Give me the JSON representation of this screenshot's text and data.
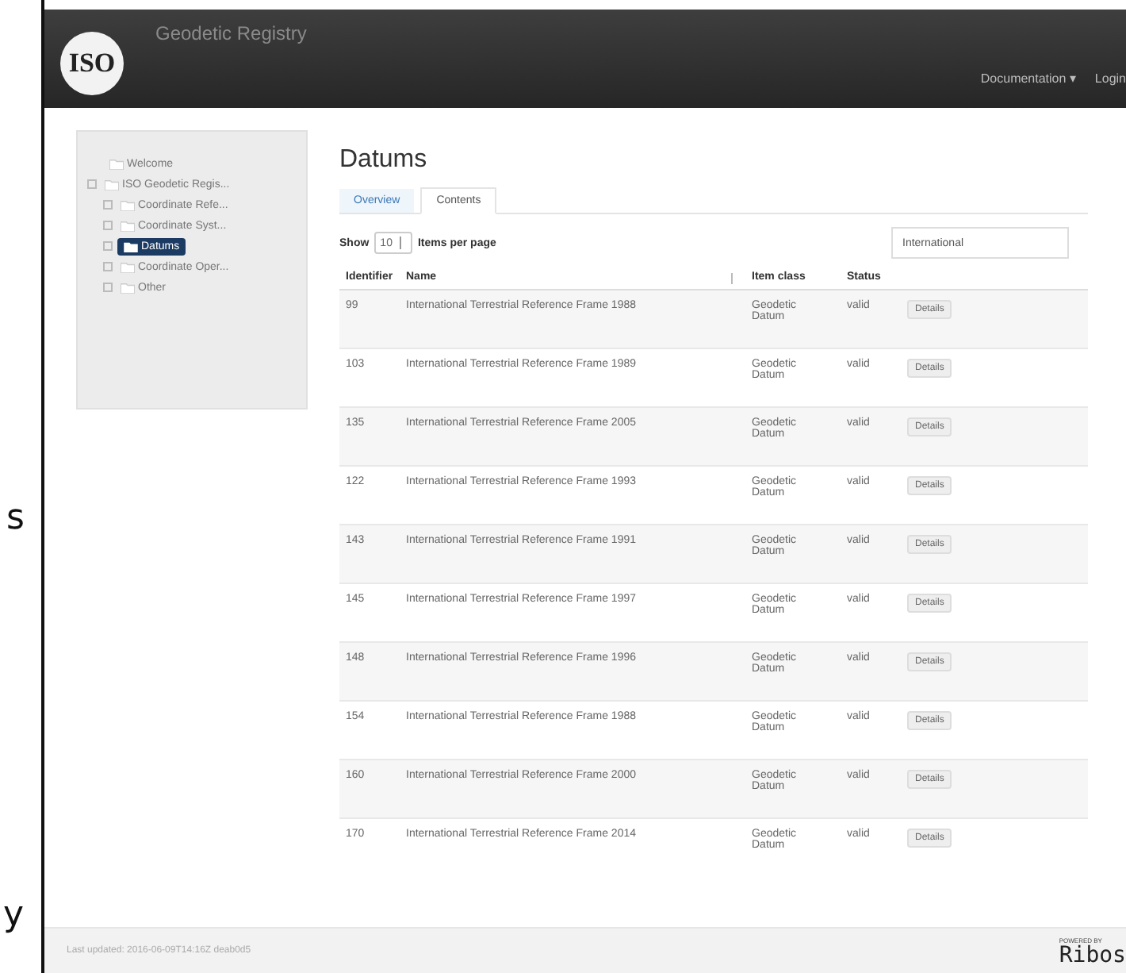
{
  "slide_text": [
    "s",
    "y"
  ],
  "header": {
    "logo": "ISO",
    "title": "Geodetic Registry",
    "nav": [
      {
        "label": "Documentation ▾"
      },
      {
        "label": "Login"
      }
    ]
  },
  "sidebar": {
    "items": [
      {
        "label": "Welcome",
        "selected": false
      },
      {
        "label": "ISO Geodetic Regis...",
        "selected": false,
        "children": [
          {
            "label": "Coordinate Refe...",
            "selected": false
          },
          {
            "label": "Coordinate Syst...",
            "selected": false
          },
          {
            "label": "Datums",
            "selected": true
          },
          {
            "label": "Coordinate Oper...",
            "selected": false
          },
          {
            "label": "Other",
            "selected": false
          }
        ]
      }
    ]
  },
  "page": {
    "title": "Datums",
    "tabs": [
      {
        "label": "Overview",
        "selected": false
      },
      {
        "label": "Contents",
        "selected": true
      }
    ],
    "show_label": "Show",
    "page_size": "10",
    "per_page_label": "Items per page",
    "search": {
      "value": "International"
    }
  },
  "table": {
    "columns": [
      "Identifier",
      "Name",
      "Item class",
      "Status"
    ],
    "rows": [
      {
        "id": "99",
        "name": "International Terrestrial Reference Frame 1988",
        "item_class": "Geodetic Datum",
        "status": "valid",
        "action": "Details"
      },
      {
        "id": "103",
        "name": "International Terrestrial Reference Frame 1989",
        "item_class": "Geodetic Datum",
        "status": "valid",
        "action": "Details"
      },
      {
        "id": "135",
        "name": "International Terrestrial Reference Frame 2005",
        "item_class": "Geodetic Datum",
        "status": "valid",
        "action": "Details"
      },
      {
        "id": "122",
        "name": "International Terrestrial Reference Frame 1993",
        "item_class": "Geodetic Datum",
        "status": "valid",
        "action": "Details"
      },
      {
        "id": "143",
        "name": "International Terrestrial Reference Frame 1991",
        "item_class": "Geodetic Datum",
        "status": "valid",
        "action": "Details"
      },
      {
        "id": "145",
        "name": "International Terrestrial Reference Frame 1997",
        "item_class": "Geodetic Datum",
        "status": "valid",
        "action": "Details"
      },
      {
        "id": "148",
        "name": "International Terrestrial Reference Frame 1996",
        "item_class": "Geodetic Datum",
        "status": "valid",
        "action": "Details"
      },
      {
        "id": "154",
        "name": "International Terrestrial Reference Frame 1988",
        "item_class": "Geodetic Datum",
        "status": "valid",
        "action": "Details"
      },
      {
        "id": "160",
        "name": "International Terrestrial Reference Frame 2000",
        "item_class": "Geodetic Datum",
        "status": "valid",
        "action": "Details"
      },
      {
        "id": "170",
        "name": "International Terrestrial Reference Frame 2014",
        "item_class": "Geodetic Datum",
        "status": "valid",
        "action": "Details"
      }
    ]
  },
  "footer": {
    "updated": "Last updated: 2016-06-09T14:16Z  deab0d5",
    "powered_by": "POWERED BY",
    "brand": "Ribos"
  }
}
